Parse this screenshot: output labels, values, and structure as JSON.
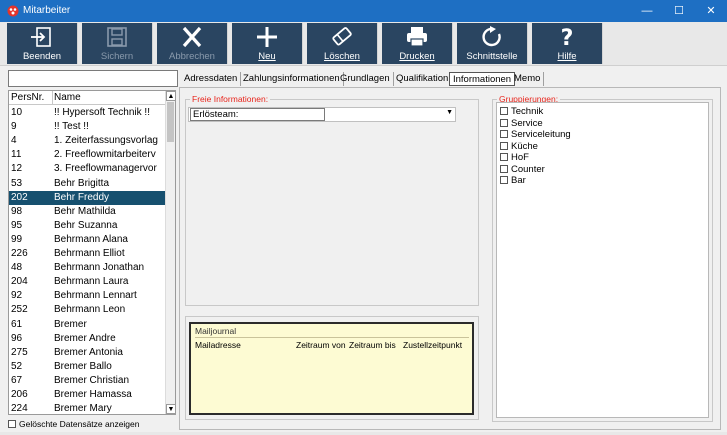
{
  "window": {
    "title": "Mitarbeiter",
    "controls": {
      "minimize": "—",
      "maximize": "☐",
      "close": "✕"
    }
  },
  "toolbar": {
    "buttons": [
      {
        "label": "Beenden",
        "icon": "exit-icon",
        "enabled": true
      },
      {
        "label": "Sichern",
        "icon": "save-icon",
        "enabled": false
      },
      {
        "label": "Abbrechen",
        "icon": "cancel-icon",
        "enabled": false
      },
      {
        "label": "Neu",
        "icon": "plus-icon",
        "enabled": true
      },
      {
        "label": "Löschen",
        "icon": "eraser-icon",
        "enabled": true
      },
      {
        "label": "Drucken",
        "icon": "printer-icon",
        "enabled": true
      },
      {
        "label": "Schnittstelle",
        "icon": "refresh-icon",
        "enabled": true
      },
      {
        "label": "Hilfe",
        "icon": "question-icon",
        "enabled": true
      }
    ]
  },
  "list": {
    "search_value": "",
    "columns": [
      "PersNr.",
      "Name"
    ],
    "rows": [
      {
        "nr": "10",
        "name": "!! Hypersoft Technik !!"
      },
      {
        "nr": "9",
        "name": "!! Test !!"
      },
      {
        "nr": "4",
        "name": "1. Zeiterfassungsvorlag"
      },
      {
        "nr": "11",
        "name": "2. Freeflowmitarbeiterv"
      },
      {
        "nr": "12",
        "name": "3. Freeflowmanagervor"
      },
      {
        "nr": "53",
        "name": "Behr Brigitta"
      },
      {
        "nr": "202",
        "name": "Behr Freddy"
      },
      {
        "nr": "98",
        "name": "Behr Mathilda"
      },
      {
        "nr": "95",
        "name": "Behr Suzanna"
      },
      {
        "nr": "99",
        "name": "Behrmann Alana"
      },
      {
        "nr": "226",
        "name": "Behrmann Elliot"
      },
      {
        "nr": "48",
        "name": "Behrmann Jonathan"
      },
      {
        "nr": "204",
        "name": "Behrmann Laura"
      },
      {
        "nr": "92",
        "name": "Behrmann Lennart"
      },
      {
        "nr": "252",
        "name": "Behrmann Leon"
      },
      {
        "nr": "61",
        "name": "Bremer"
      },
      {
        "nr": "96",
        "name": "Bremer Andre"
      },
      {
        "nr": "275",
        "name": "Bremer Antonia"
      },
      {
        "nr": "52",
        "name": "Bremer Ballo"
      },
      {
        "nr": "67",
        "name": "Bremer Christian"
      },
      {
        "nr": "206",
        "name": "Bremer Hamassa"
      },
      {
        "nr": "224",
        "name": "Bremer Mary"
      }
    ],
    "selected_nr": "202",
    "show_deleted_label": "Gelöschte Datensätze anzeigen"
  },
  "tabs": [
    "Adressdaten",
    "Zahlungsinformationen",
    "Grundlagen",
    "Qualifikation",
    "Informationen",
    "Memo"
  ],
  "active_tab": "Informationen",
  "freie_informationen": {
    "legend": "Freie Informationen:",
    "field_label": "Erlösteam:",
    "value": ""
  },
  "mailjournal": {
    "title": "Mailjournal",
    "columns": [
      "Mailadresse",
      "Zeitraum von",
      "Zeitraum bis",
      "Zustellzeitpunkt"
    ]
  },
  "gruppierungen": {
    "legend": "Gruppierungen:",
    "items": [
      "Technik",
      "Service",
      "Serviceleitung",
      "Küche",
      "HoF",
      "Counter",
      "Bar"
    ]
  },
  "colors": {
    "titlebar": "#1e6fc3",
    "toolbar_button": "#2a4561",
    "selection": "#16506f",
    "legend_text": "#e8251c",
    "mailjournal_bg": "#fdfbd3"
  }
}
